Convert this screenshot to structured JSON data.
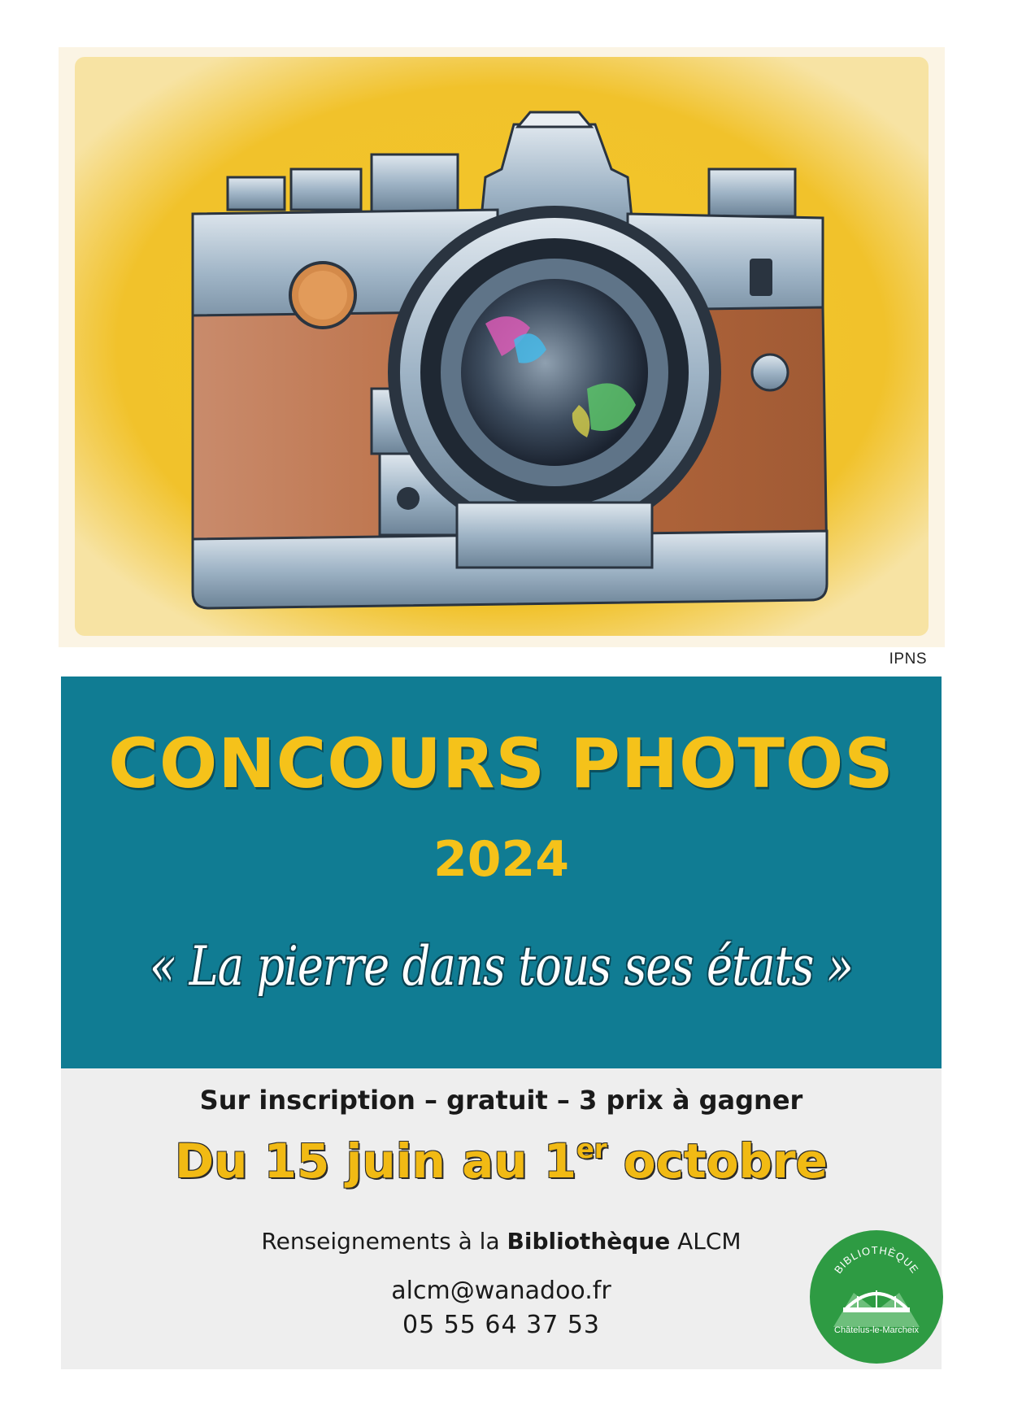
{
  "credit": "IPNS",
  "poster": {
    "title": "CONCOURS PHOTOS",
    "year": "2024",
    "theme": "« La pierre dans tous ses états »",
    "conditions": "Sur inscription – gratuit – 3 prix à gagner",
    "dates_prefix": "Du 15 juin au 1",
    "dates_sup": "er",
    "dates_suffix": " octobre",
    "info_prefix": "Renseignements à la ",
    "info_bold": "Bibliothèque",
    "info_suffix": " ALCM",
    "email": "alcm@wanadoo.fr",
    "phone": "05 55 64 37 53"
  },
  "logo": {
    "top_text": "BIBLIOTHÈQUE",
    "bottom_text": "Châtelus-le-Marcheix",
    "color": "#2e9b43"
  },
  "colors": {
    "banner": "#107c93",
    "accent_yellow": "#f5c21a",
    "info_bg": "#eeeeee"
  },
  "illustration": {
    "icon": "camera-illustration"
  }
}
